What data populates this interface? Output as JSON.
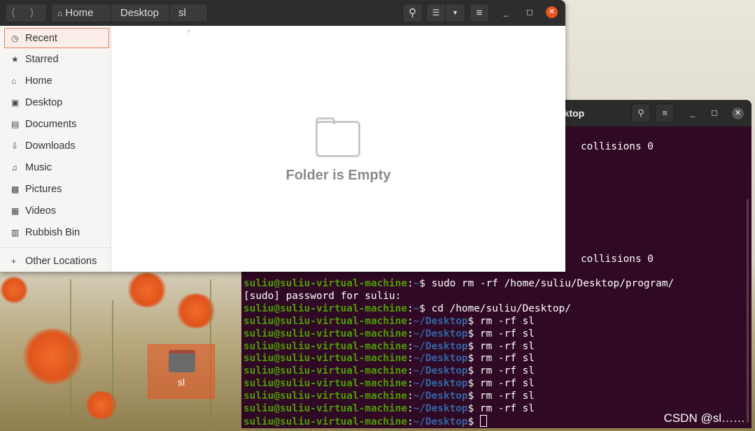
{
  "file_manager": {
    "path": [
      "Home",
      "Desktop",
      "sl"
    ],
    "sidebar": [
      {
        "label": "Recent",
        "icon": "clock-icon"
      },
      {
        "label": "Starred",
        "icon": "star-icon"
      },
      {
        "label": "Home",
        "icon": "home-icon"
      },
      {
        "label": "Desktop",
        "icon": "desktop-icon"
      },
      {
        "label": "Documents",
        "icon": "document-icon"
      },
      {
        "label": "Downloads",
        "icon": "download-icon"
      },
      {
        "label": "Music",
        "icon": "music-icon"
      },
      {
        "label": "Pictures",
        "icon": "picture-icon"
      },
      {
        "label": "Videos",
        "icon": "video-icon"
      },
      {
        "label": "Rubbish Bin",
        "icon": "trash-icon"
      }
    ],
    "other_locations": "Other Locations",
    "empty_text": "Folder is Empty"
  },
  "terminal": {
    "title": "esktop",
    "partial_lines": [
      "collisions 0",
      "collisions 0"
    ],
    "lines": [
      {
        "user": "suliu@suliu-virtual-machine",
        "path": "~",
        "cmd": " sudo rm -rf /home/suliu/Desktop/program/"
      },
      {
        "text": "[sudo] password for suliu:"
      },
      {
        "user": "suliu@suliu-virtual-machine",
        "path": "~",
        "cmd": " cd /home/suliu/Desktop/"
      },
      {
        "user": "suliu@suliu-virtual-machine",
        "path": "~/Desktop",
        "cmd": " rm -rf sl"
      },
      {
        "user": "suliu@suliu-virtual-machine",
        "path": "~/Desktop",
        "cmd": " rm -rf sl"
      },
      {
        "user": "suliu@suliu-virtual-machine",
        "path": "~/Desktop",
        "cmd": " rm -rf sl"
      },
      {
        "user": "suliu@suliu-virtual-machine",
        "path": "~/Desktop",
        "cmd": " rm -rf sl"
      },
      {
        "user": "suliu@suliu-virtual-machine",
        "path": "~/Desktop",
        "cmd": " rm -rf sl"
      },
      {
        "user": "suliu@suliu-virtual-machine",
        "path": "~/Desktop",
        "cmd": " rm -rf sl"
      },
      {
        "user": "suliu@suliu-virtual-machine",
        "path": "~/Desktop",
        "cmd": " rm -rf sl"
      },
      {
        "user": "suliu@suliu-virtual-machine",
        "path": "~/Desktop",
        "cmd": " rm -rf sl"
      },
      {
        "user": "suliu@suliu-virtual-machine",
        "path": "~/Desktop",
        "cmd": " ",
        "cursor": true
      }
    ]
  },
  "desktop": {
    "icon_label": "sl"
  },
  "watermark": "CSDN @sl……",
  "colors": {
    "accent": "#e95420",
    "terminal_bg": "#300a24",
    "prompt_user": "#4e9a06",
    "prompt_path": "#3465a4"
  }
}
